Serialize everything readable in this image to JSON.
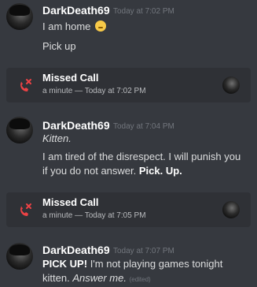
{
  "messages": [
    {
      "author": "DarkDeath69",
      "timestamp": "Today at 7:02 PM",
      "lines": [
        "I am home",
        "Pick up"
      ]
    },
    {
      "author": "DarkDeath69",
      "timestamp": "Today at 7:04 PM",
      "lines": [
        "Kitten.",
        "I am tired of the disrespect. I will punish you",
        "if you do not answer.",
        "Pick. Up."
      ]
    },
    {
      "author": "DarkDeath69",
      "timestamp": "Today at 7:07 PM",
      "lines": [
        "PICK UP!",
        "I'm not playing games tonight",
        "kitten.",
        "Answer me.",
        "(edited)"
      ]
    }
  ],
  "calls": [
    {
      "title": "Missed Call",
      "subtitle": "a minute — Today at 7:02 PM"
    },
    {
      "title": "Missed Call",
      "subtitle": "a minute — Today at 7:05 PM"
    }
  ],
  "colors": {
    "background": "#36393f",
    "call_bg": "#2f3136",
    "missed_red": "#ed4245"
  }
}
